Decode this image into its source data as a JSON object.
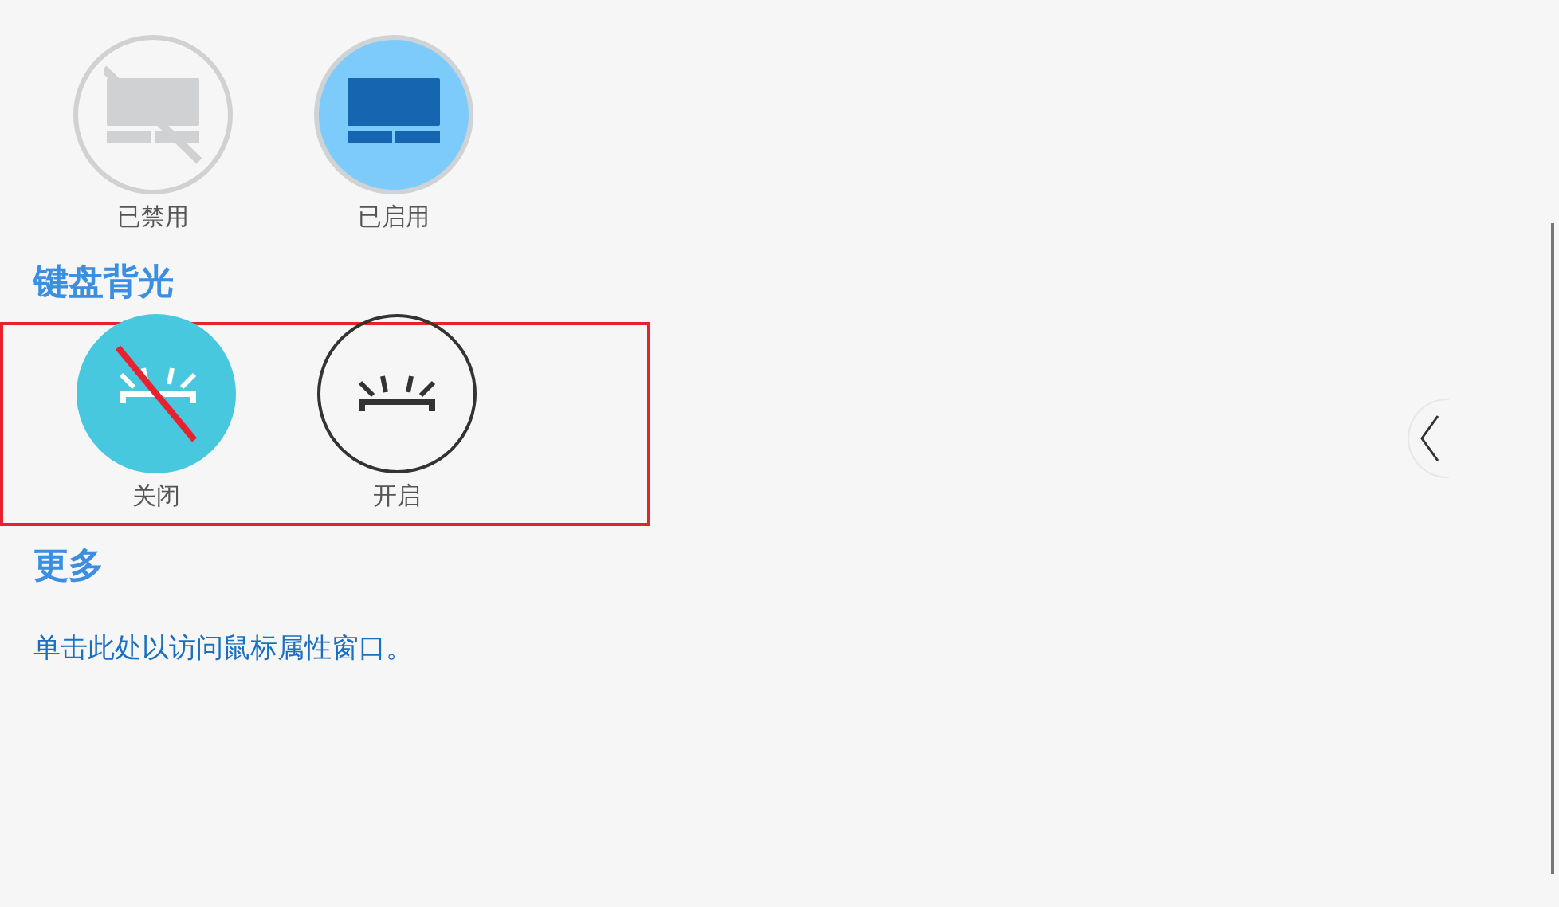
{
  "touchpad": {
    "options": [
      {
        "kind": "off",
        "label": "已禁用",
        "selected": false
      },
      {
        "kind": "on",
        "label": "已启用",
        "selected": true
      }
    ]
  },
  "keyboard_backlight": {
    "heading": "键盘背光",
    "highlighted": true,
    "options": [
      {
        "kind": "off",
        "label": "关闭",
        "selected": true
      },
      {
        "kind": "on",
        "label": "开启",
        "selected": false
      }
    ]
  },
  "more": {
    "heading": "更多",
    "link": "单击此处以访问鼠标属性窗口。"
  }
}
